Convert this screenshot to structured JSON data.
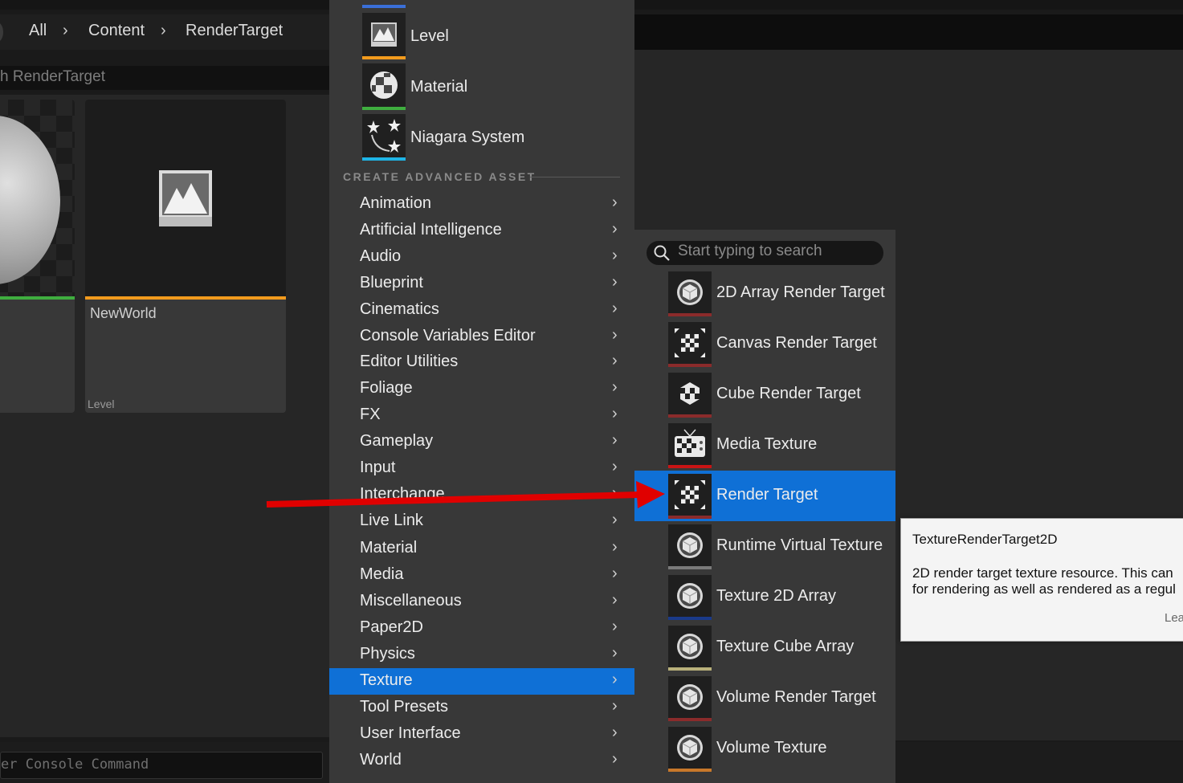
{
  "breadcrumb": {
    "all": "All",
    "sep": "›",
    "content": "Content",
    "current": "RenderTarget"
  },
  "search": {
    "value": "h RenderTarget"
  },
  "tiles": {
    "world_name": "NewWorld",
    "world_type": "Level"
  },
  "console": {
    "placeholder": "er Console Command"
  },
  "basic_assets": [
    {
      "label": "Level",
      "icon": "level-icon",
      "color": "#f29b1d"
    },
    {
      "label": "Material",
      "icon": "material-icon",
      "color": "#3fae3f"
    },
    {
      "label": "Niagara System",
      "icon": "niagara-icon",
      "color": "#1eb4e6"
    }
  ],
  "section_header": "CREATE ADVANCED ASSET",
  "categories": [
    "Animation",
    "Artificial Intelligence",
    "Audio",
    "Blueprint",
    "Cinematics",
    "Console Variables Editor",
    "Editor Utilities",
    "Foliage",
    "FX",
    "Gameplay",
    "Input",
    "Interchange",
    "Live Link",
    "Material",
    "Media",
    "Miscellaneous",
    "Paper2D",
    "Physics",
    "Texture",
    "Tool Presets",
    "User Interface",
    "World"
  ],
  "selected_category": "Texture",
  "submenu": {
    "search_placeholder": "Start typing to search",
    "items": [
      {
        "label": "2D Array Render Target",
        "icon": "cube-icon",
        "color": "#8b2b2b"
      },
      {
        "label": "Canvas Render Target",
        "icon": "canvas-render-target-icon",
        "color": "#8b2b2b"
      },
      {
        "label": "Cube Render Target",
        "icon": "cube-render-target-icon",
        "color": "#8b2b2b"
      },
      {
        "label": "Media Texture",
        "icon": "tv-icon",
        "color": "#c81414"
      },
      {
        "label": "Render Target",
        "icon": "render-target-icon",
        "color": "#8b2b2b"
      },
      {
        "label": "Runtime Virtual Texture",
        "icon": "cube-icon",
        "color": "#7a7a7a"
      },
      {
        "label": "Texture 2D Array",
        "icon": "cube-icon",
        "color": "#1a3a8a"
      },
      {
        "label": "Texture Cube Array",
        "icon": "cube-icon",
        "color": "#b8b07a"
      },
      {
        "label": "Volume Render Target",
        "icon": "cube-icon",
        "color": "#8b2b2b"
      },
      {
        "label": "Volume Texture",
        "icon": "cube-icon",
        "color": "#c8782a"
      }
    ],
    "selected": "Render Target"
  },
  "tooltip": {
    "title": "TextureRenderTarget2D",
    "line1": "2D render target texture resource. This can",
    "line2": "for rendering as well as rendered as a regul",
    "link": "Lea"
  },
  "colors": {
    "accent": "#0f70d6",
    "menu_bg": "#383838",
    "arrow": "#e00000"
  }
}
